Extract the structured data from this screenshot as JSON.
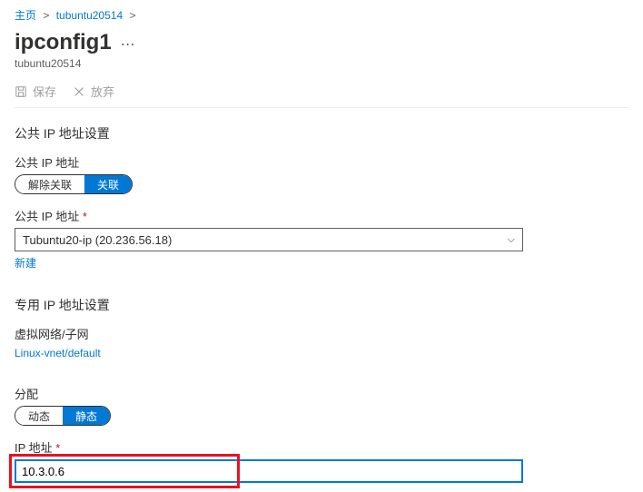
{
  "breadcrumb": {
    "home": "主页",
    "parent": "tubuntu20514"
  },
  "header": {
    "title": "ipconfig1",
    "subtitle": "tubuntu20514"
  },
  "toolbar": {
    "save": "保存",
    "discard": "放弃"
  },
  "public_ip": {
    "section_title": "公共 IP 地址设置",
    "toggle_label": "公共 IP 地址",
    "toggle_off": "解除关联",
    "toggle_on": "关联",
    "address_label": "公共 IP 地址",
    "selected": "Tubuntu20-ip (20.236.56.18)",
    "create_new": "新建"
  },
  "private_ip": {
    "section_title": "专用 IP 地址设置",
    "vnet_label": "虚拟网络/子网",
    "vnet_value": "Linux-vnet/default",
    "alloc_label": "分配",
    "alloc_dynamic": "动态",
    "alloc_static": "静态",
    "ip_label": "IP 地址",
    "ip_value": "10.3.0.6"
  }
}
